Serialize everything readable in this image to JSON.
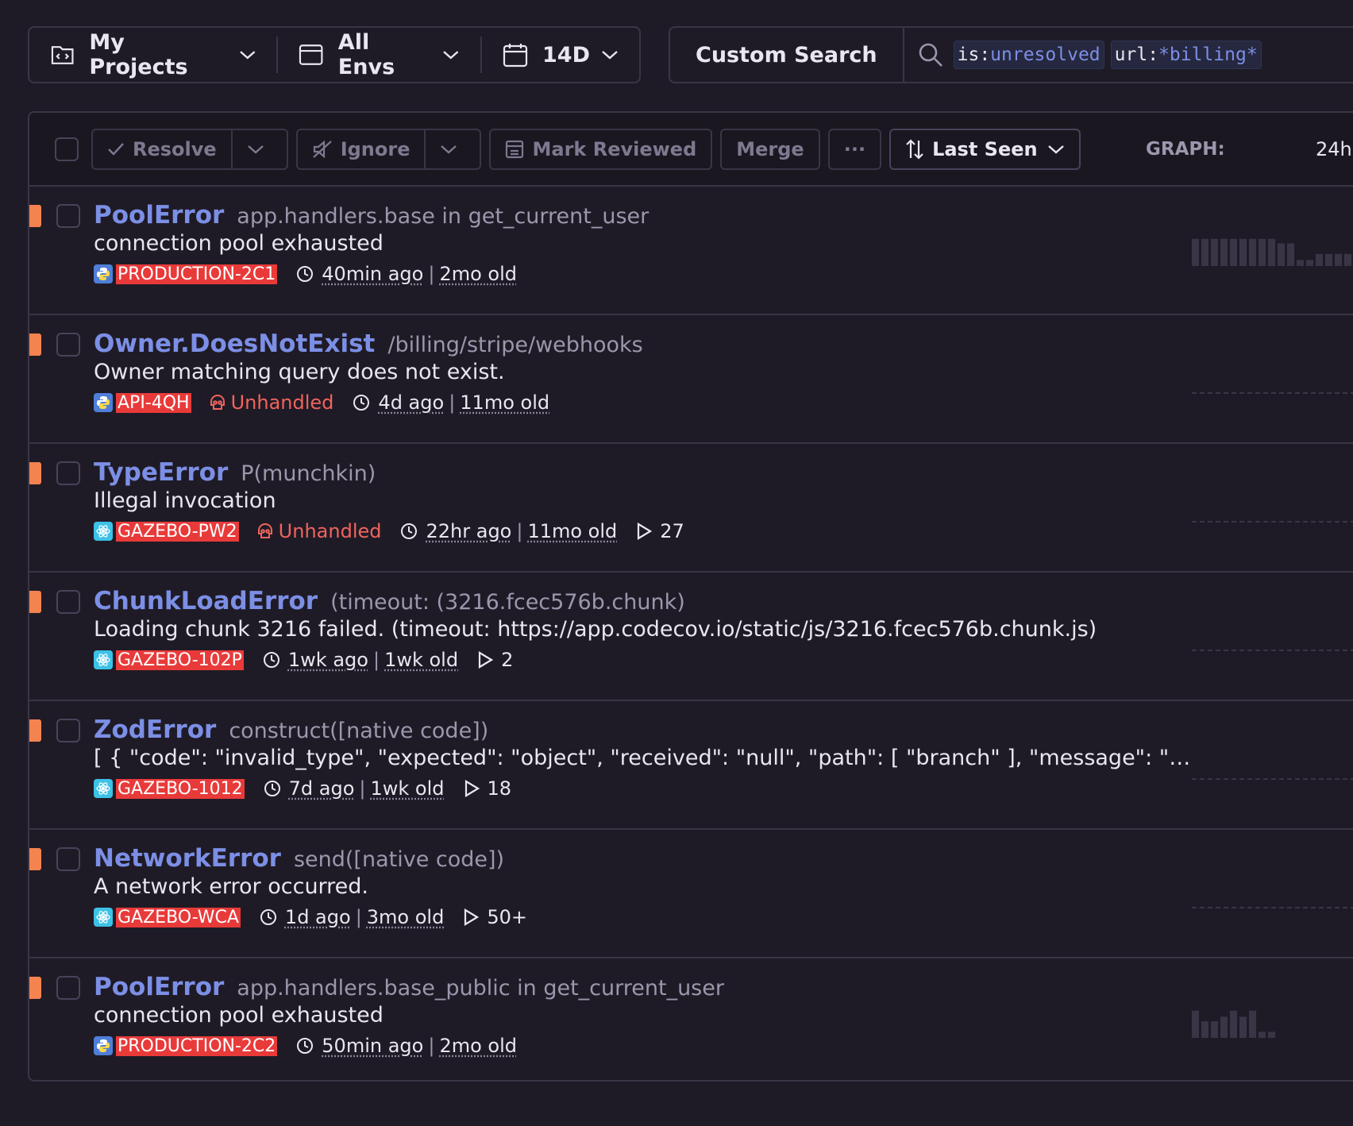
{
  "filters": {
    "projects": "My Projects",
    "envs": "All Envs",
    "period": "14D"
  },
  "search": {
    "custom_label": "Custom Search",
    "tokens": [
      {
        "key": "is:",
        "value": "unresolved"
      },
      {
        "key": "url:",
        "value": "*billing*"
      }
    ]
  },
  "toolbar": {
    "resolve": "Resolve",
    "ignore": "Ignore",
    "mark_reviewed": "Mark Reviewed",
    "merge": "Merge",
    "more": "···",
    "sort": "Last Seen",
    "graph_label": "GRAPH:",
    "graph_range": "24h"
  },
  "colors": {
    "accent": "#7c8fe6",
    "level_error": "#f4834f",
    "short_id_bg": "#e93a3a",
    "unhandled": "#f0645d"
  },
  "issues": [
    {
      "title": "PoolError",
      "location": "app.handlers.base in get_current_user",
      "message": "connection pool exhausted",
      "platform": "python",
      "short_id": "PRODUCTION-2C1",
      "unhandled": "",
      "last_seen": "40min ago",
      "age": "2mo old",
      "events": "",
      "spark": [
        0.9,
        0.9,
        0.9,
        0.9,
        0.9,
        0.9,
        0.9,
        0.9,
        0.9,
        0.75,
        0.75,
        0.2,
        0.2,
        0.4,
        0.4,
        0.4,
        0.4,
        0.4,
        0.4,
        0.4
      ]
    },
    {
      "title": "Owner.DoesNotExist",
      "location": "/billing/stripe/webhooks",
      "message": "Owner matching query does not exist.",
      "platform": "python",
      "short_id": "API-4QH",
      "unhandled": "Unhandled",
      "last_seen": "4d ago",
      "age": "11mo old",
      "events": "",
      "spark": []
    },
    {
      "title": "TypeError",
      "location": "P(munchkin)",
      "message": "Illegal invocation",
      "platform": "react",
      "short_id": "GAZEBO-PW2",
      "unhandled": "Unhandled",
      "last_seen": "22hr ago",
      "age": "11mo old",
      "events": "27",
      "spark": []
    },
    {
      "title": "ChunkLoadError",
      "location": "(timeout: (3216.fcec576b.chunk)",
      "message": "Loading chunk 3216 failed. (timeout: https://app.codecov.io/static/js/3216.fcec576b.chunk.js)",
      "platform": "react",
      "short_id": "GAZEBO-102P",
      "unhandled": "",
      "last_seen": "1wk ago",
      "age": "1wk old",
      "events": "2",
      "spark": []
    },
    {
      "title": "ZodError",
      "location": "construct([native code])",
      "message": "[ { \"code\": \"invalid_type\", \"expected\": \"object\", \"received\": \"null\", \"path\": [ \"branch\" ], \"message\": \"…",
      "platform": "react",
      "short_id": "GAZEBO-1012",
      "unhandled": "",
      "last_seen": "7d ago",
      "age": "1wk old",
      "events": "18",
      "spark": []
    },
    {
      "title": "NetworkError",
      "location": "send([native code])",
      "message": "A network error occurred.",
      "platform": "react",
      "short_id": "GAZEBO-WCA",
      "unhandled": "",
      "last_seen": "1d ago",
      "age": "3mo old",
      "events": "50+",
      "spark": []
    },
    {
      "title": "PoolError",
      "location": "app.handlers.base_public in get_current_user",
      "message": "connection pool exhausted",
      "platform": "python",
      "short_id": "PRODUCTION-2C2",
      "unhandled": "",
      "last_seen": "50min ago",
      "age": "2mo old",
      "events": "",
      "spark": [
        0.9,
        0.55,
        0.55,
        0.7,
        0.9,
        0.7,
        0.9,
        0.2,
        0.2
      ]
    }
  ]
}
